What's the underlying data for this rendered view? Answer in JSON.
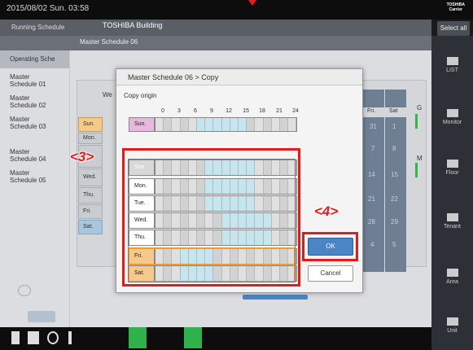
{
  "topbar": {
    "datetime": "2015/08/02 Sun. 03:58",
    "logo_line1": "TOSHIBA",
    "logo_line2": "Carrier"
  },
  "subheader": {
    "running_schedule": "Running Schedule",
    "building": "TOSHIBA Building"
  },
  "select_all": "Select all",
  "background_window_title": "Master Schedule 06",
  "operating_schedule": "Operating Sche",
  "sidebar": {
    "items": [
      {
        "line1": "Master",
        "line2": "Schedule 01"
      },
      {
        "line1": "Master",
        "line2": "Schedule 02"
      },
      {
        "line1": "Master",
        "line2": "Schedule 03"
      },
      {
        "line1": "Master",
        "line2": "Schedule 04"
      },
      {
        "line1": "Master",
        "line2": "Schedule 05"
      }
    ]
  },
  "background_calendar": {
    "we_label": "We",
    "fri": "Fri.",
    "sat": "Sat",
    "dates_col1": [
      "",
      "",
      "31",
      "7",
      "14",
      "21",
      "28",
      "4"
    ],
    "dates_col2": [
      "",
      "",
      "1",
      "8",
      "15",
      "22",
      "29",
      "5"
    ],
    "days": [
      "Sun.",
      "Mon.",
      "Tue.",
      "Wed.",
      "Thu.",
      "Fri.",
      "Sat."
    ],
    "g_label": "G",
    "m_label": "M"
  },
  "right_menu": [
    {
      "label": "LIST",
      "icon": "list-icon"
    },
    {
      "label": "Monitor",
      "icon": "monitor-icon"
    },
    {
      "label": "Floor",
      "icon": "floor-icon"
    },
    {
      "label": "Tenant",
      "icon": "tenant-icon"
    },
    {
      "label": "Area",
      "icon": "area-icon"
    },
    {
      "label": "Unit",
      "icon": "unit-icon"
    }
  ],
  "dialog": {
    "title": "Master Schedule 06 > Copy",
    "copy_origin_label": "Copy origin",
    "time_ticks": [
      "0",
      "3",
      "6",
      "9",
      "12",
      "15",
      "18",
      "21",
      "24"
    ],
    "origin_row": {
      "day": "Sun.",
      "on_slots": [
        5,
        6,
        7,
        8,
        9,
        10
      ]
    },
    "target_rows": [
      {
        "day": "Sun.",
        "on_slots": [
          6,
          7,
          8,
          9,
          10,
          11
        ]
      },
      {
        "day": "Mon.",
        "on_slots": [
          6,
          7,
          8,
          9,
          10,
          11
        ]
      },
      {
        "day": "Tue.",
        "on_slots": [
          6,
          7,
          8,
          9,
          10,
          11
        ]
      },
      {
        "day": "Wed.",
        "on_slots": [
          8,
          9,
          10,
          11,
          12,
          13
        ]
      },
      {
        "day": "Thu.",
        "on_slots": [
          8,
          9,
          10,
          11,
          12,
          13
        ]
      },
      {
        "day": "Fri.",
        "on_slots": [
          3,
          4,
          5,
          6
        ]
      },
      {
        "day": "Sat.",
        "on_slots": [
          3,
          4,
          5,
          6
        ]
      }
    ],
    "ok_label": "OK",
    "cancel_label": "Cancel"
  },
  "annotations": {
    "step3": "<3>",
    "step4": "<4>",
    "color": "#e21b1b"
  },
  "colors": {
    "on_slot": "#c5e6ee",
    "ok_button": "#4a86c6",
    "origin_day": "#e7b9df",
    "selected_day": "#f4c98a",
    "selected_border": "#f29a2e"
  }
}
